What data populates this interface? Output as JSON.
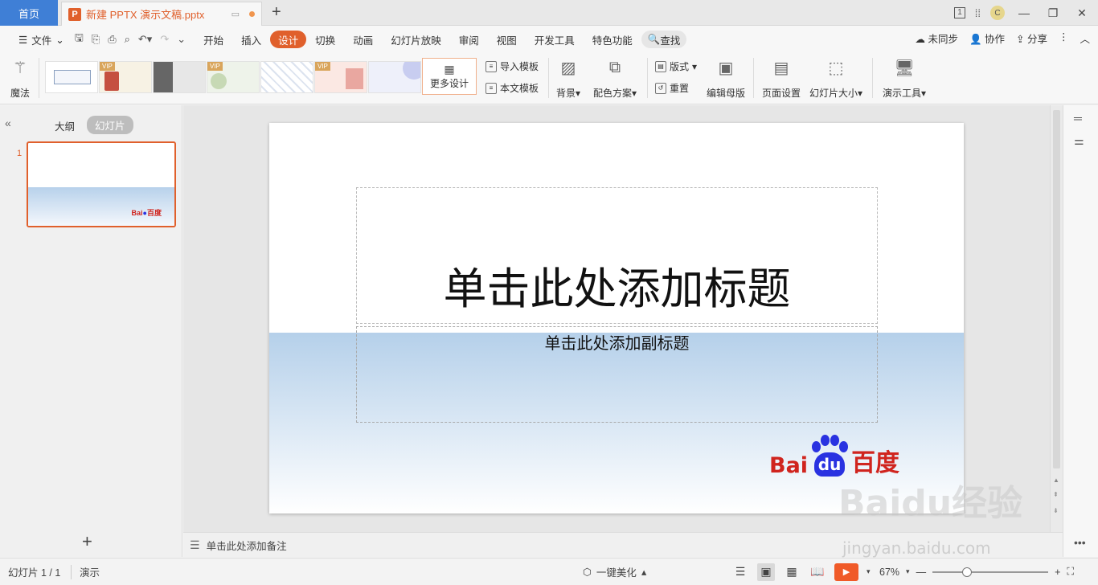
{
  "titlebar": {
    "home_tab": "首页",
    "doc_tab": "新建 PPTX 演示文稿.pptx",
    "doc_tab_icon": "P",
    "badge": "1",
    "avatar": "C",
    "new_tab": "+"
  },
  "menu": {
    "file": "文件",
    "items": [
      "开始",
      "插入",
      "设计",
      "切换",
      "动画",
      "幻灯片放映",
      "审阅",
      "视图",
      "开发工具",
      "特色功能"
    ],
    "active": "设计",
    "search": "查找",
    "right": [
      "未同步",
      "协作",
      "分享"
    ]
  },
  "ribbon": {
    "magic": "魔法",
    "vip": "VIP",
    "more_design": "更多设计",
    "import_template": "导入模板",
    "this_template": "本文模板",
    "background": "背景",
    "color_scheme": "配色方案",
    "layout": "版式",
    "reset": "重置",
    "edit_master": "编辑母版",
    "page_setup": "页面设置",
    "slide_size": "幻灯片大小",
    "present_tools": "演示工具"
  },
  "left_panel": {
    "tab_outline": "大纲",
    "tab_slides": "幻灯片",
    "slide_number": "1",
    "add": "+"
  },
  "slide": {
    "title_placeholder": "单击此处添加标题",
    "subtitle_placeholder": "单击此处添加副标题",
    "logo_bai": "Bai",
    "logo_du": "du",
    "logo_cn": "百度"
  },
  "notes": {
    "placeholder": "单击此处添加备注"
  },
  "statusbar": {
    "slide_count": "幻灯片 1 / 1",
    "present_mode": "演示",
    "beautify": "一键美化",
    "zoom": "67%",
    "zoom_fraction": 0.3
  },
  "watermark": {
    "main": "Baidu经验",
    "sub": "jingyan.baidu.com"
  },
  "colors": {
    "accent": "#e0602c",
    "home_tab": "#3f7fd6",
    "baidu_red": "#d0241e",
    "baidu_blue": "#2932e1"
  }
}
